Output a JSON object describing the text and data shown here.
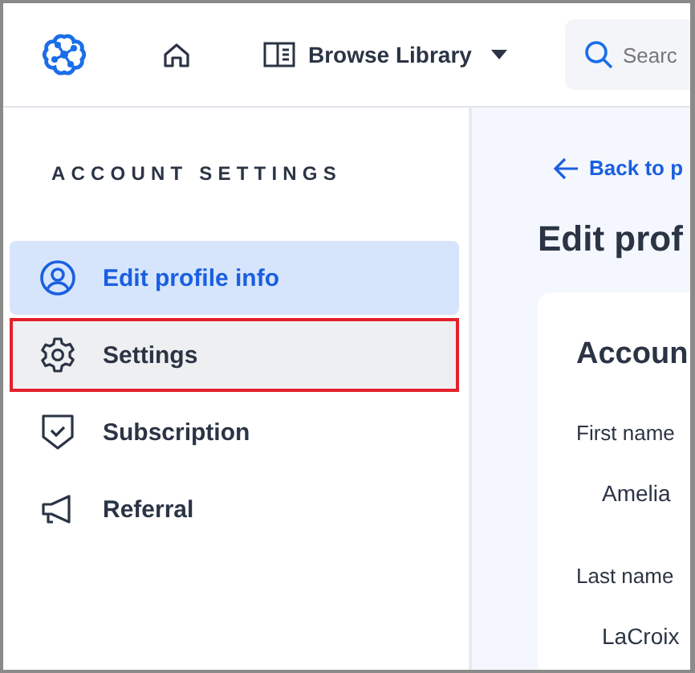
{
  "header": {
    "nav": [
      {
        "kind": "logo"
      },
      {
        "kind": "home"
      },
      {
        "kind": "library",
        "label": "Browse Library"
      }
    ],
    "search": {
      "placeholder": "Searc"
    }
  },
  "sidebar": {
    "heading": "ACCOUNT SETTINGS",
    "items": [
      {
        "label": "Edit profile info",
        "kind": "user",
        "selected": true,
        "highlighted": false
      },
      {
        "label": "Settings",
        "kind": "gear",
        "selected": false,
        "highlighted": true
      },
      {
        "label": "Subscription",
        "kind": "shield",
        "selected": false,
        "highlighted": false
      },
      {
        "label": "Referral",
        "kind": "megaphone",
        "selected": false,
        "highlighted": false
      }
    ]
  },
  "main": {
    "back_link": "Back to p",
    "title": "Edit prof",
    "card": {
      "heading": "Accoun",
      "fields": [
        {
          "label": "First name",
          "value": "Amelia"
        },
        {
          "label": "Last name",
          "value": "LaCroix"
        }
      ]
    }
  }
}
